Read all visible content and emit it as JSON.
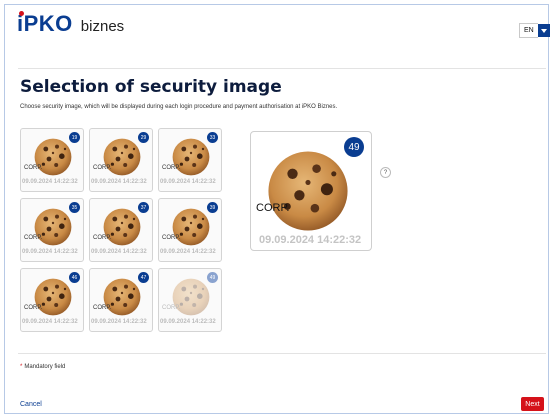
{
  "header": {
    "logo_mark": "iPKO",
    "logo_text": "biznes",
    "language": "EN"
  },
  "page": {
    "title": "Selection of security image",
    "description": "Choose security image, which will be displayed during each login procedure and payment authorisation at iPKO Biznes."
  },
  "images": [
    {
      "number": "19",
      "corp": "CORP.",
      "stamp": "09.09.2024 14:22:32"
    },
    {
      "number": "29",
      "corp": "CORP.",
      "stamp": "09.09.2024 14:22:32"
    },
    {
      "number": "33",
      "corp": "CORP.",
      "stamp": "09.09.2024 14:22:32"
    },
    {
      "number": "35",
      "corp": "CORP.",
      "stamp": "09.09.2024 14:22:32"
    },
    {
      "number": "37",
      "corp": "CORP.",
      "stamp": "09.09.2024 14:22:32"
    },
    {
      "number": "39",
      "corp": "CORP.",
      "stamp": "09.09.2024 14:22:32"
    },
    {
      "number": "46",
      "corp": "CORP.",
      "stamp": "09.09.2024 14:22:32"
    },
    {
      "number": "47",
      "corp": "CORP.",
      "stamp": "09.09.2024 14:22:32"
    },
    {
      "number": "49",
      "corp": "CORP.",
      "stamp": "09.09.2024 14:22:32",
      "selected": true
    }
  ],
  "preview": {
    "number": "49",
    "corp": "CORP.",
    "stamp": "09.09.2024 14:22:32",
    "help": "?"
  },
  "footer": {
    "mandatory_star": "*",
    "mandatory": "Mandatory field",
    "cancel": "Cancel",
    "next": "Next"
  },
  "colors": {
    "brand": "#0a3d91",
    "accent": "#d5121a"
  }
}
